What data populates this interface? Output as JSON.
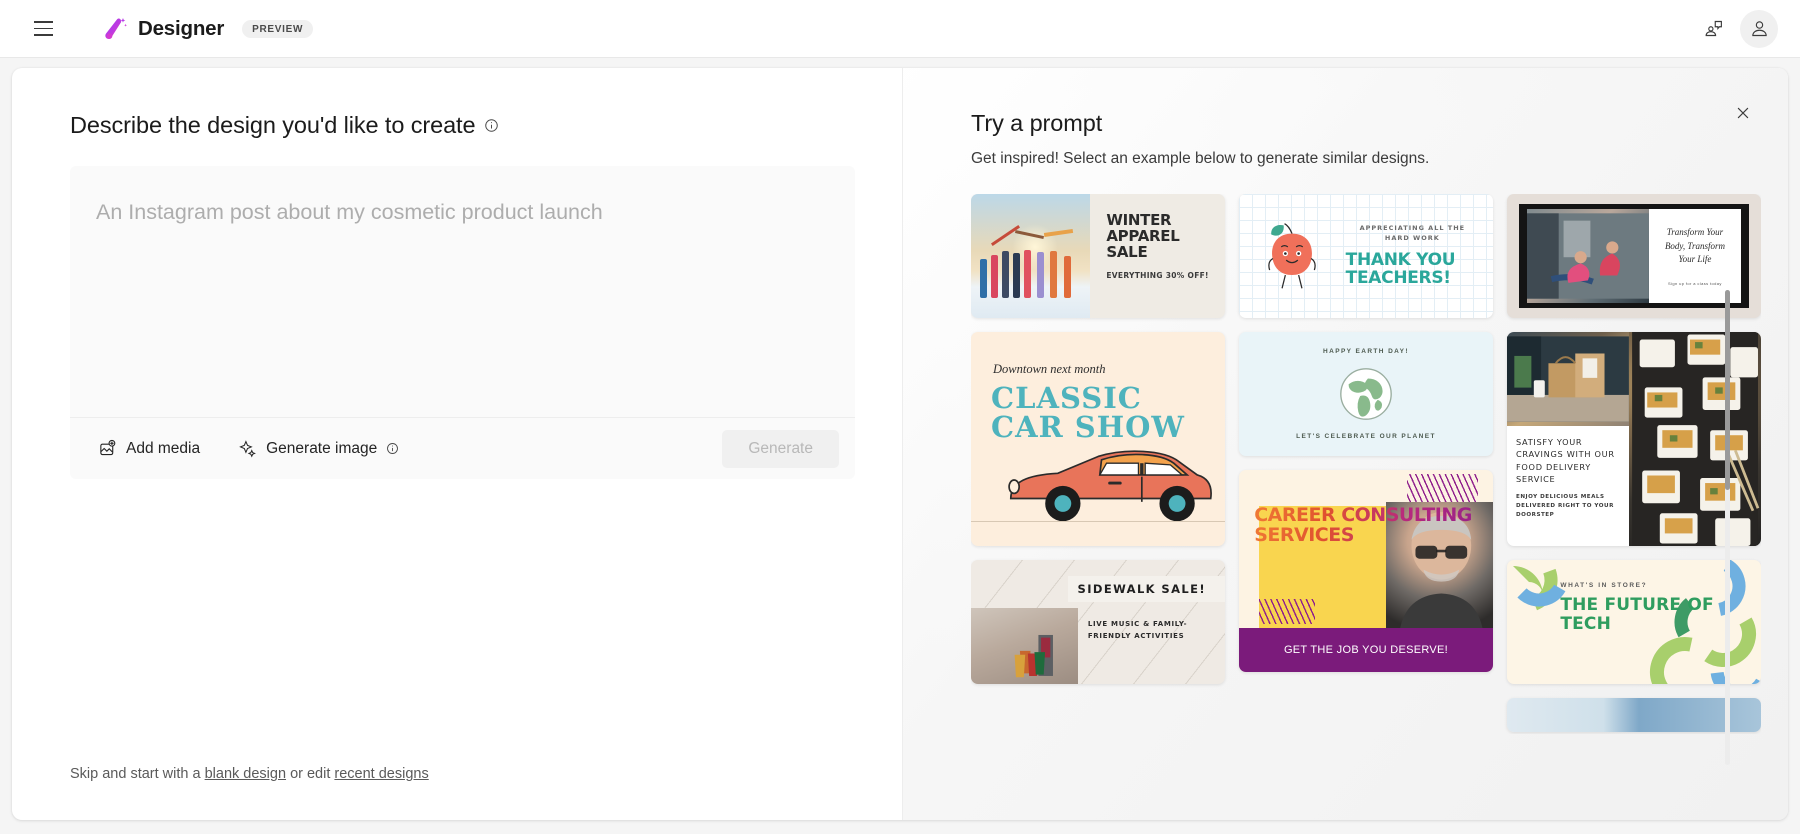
{
  "app": {
    "brand_name": "Designer",
    "preview_badge": "PREVIEW",
    "logo_icon": "designer-wand-logo",
    "menu_icon": "hamburger-menu-icon",
    "feedback_icon": "feedback-chat-icon",
    "account_icon": "account-person-icon"
  },
  "left": {
    "title": "Describe the design you'd like to create",
    "title_info_icon": "info-circle-icon",
    "prompt_placeholder": "An Instagram post about my cosmetic product launch",
    "prompt_value": "",
    "add_media_label": "Add media",
    "add_media_icon": "add-image-icon",
    "generate_image_label": "Generate image",
    "generate_image_icon": "sparkle-icon",
    "generate_image_info_icon": "info-circle-icon",
    "generate_button": "Generate",
    "footer_prefix": "Skip and start with a",
    "footer_link_blank": "blank design",
    "footer_middle": "or edit",
    "footer_link_recent": "recent designs"
  },
  "right": {
    "title": "Try a prompt",
    "subtitle": "Get inspired! Select an example below to generate similar designs.",
    "close_icon": "close-x-icon",
    "cards": [
      {
        "id": "winter-apparel-sale",
        "headline": "WINTER APPAREL SALE",
        "subline": "EVERYTHING 30% OFF!"
      },
      {
        "id": "thank-you-teachers",
        "eyebrow": "APPRECIATING ALL THE HARD WORK",
        "headline": "THANK YOU TEACHERS!"
      },
      {
        "id": "transform-your-body",
        "headline": "Transform Your Body, Transform Your Life",
        "subline": "Sign up for a class today"
      },
      {
        "id": "classic-car-show",
        "eyebrow": "Downtown next month",
        "headline": "CLASSIC CAR SHOW"
      },
      {
        "id": "happy-earth-day",
        "eyebrow": "HAPPY EARTH DAY!",
        "subline": "LET'S CELEBRATE OUR PLANET"
      },
      {
        "id": "food-delivery-service",
        "headline": "SATISFY YOUR CRAVINGS WITH OUR FOOD DELIVERY SERVICE",
        "subline": "ENJOY DELICIOUS MEALS DELIVERED RIGHT TO YOUR DOORSTEP"
      },
      {
        "id": "sidewalk-sale",
        "headline": "SIDEWALK SALE!",
        "subline": "LIVE MUSIC & FAMILY-FRIENDLY ACTIVITIES"
      },
      {
        "id": "career-consulting-services",
        "headline": "CAREER CONSULTING SERVICES",
        "banner": "GET THE JOB YOU DESERVE!"
      },
      {
        "id": "future-of-tech",
        "eyebrow": "WHAT'S IN STORE?",
        "headline": "THE FUTURE OF TECH"
      }
    ],
    "scrollbar": {
      "name": "prompt-gallery-scrollbar"
    }
  },
  "colors": {
    "brand_purple": "#8b2bd9",
    "brand_pink": "#e043b3",
    "page_bg": "#f5f5f5",
    "card_bg": "#ffffff",
    "input_bg": "#fafafa",
    "disabled_text": "#b8b8b8"
  }
}
